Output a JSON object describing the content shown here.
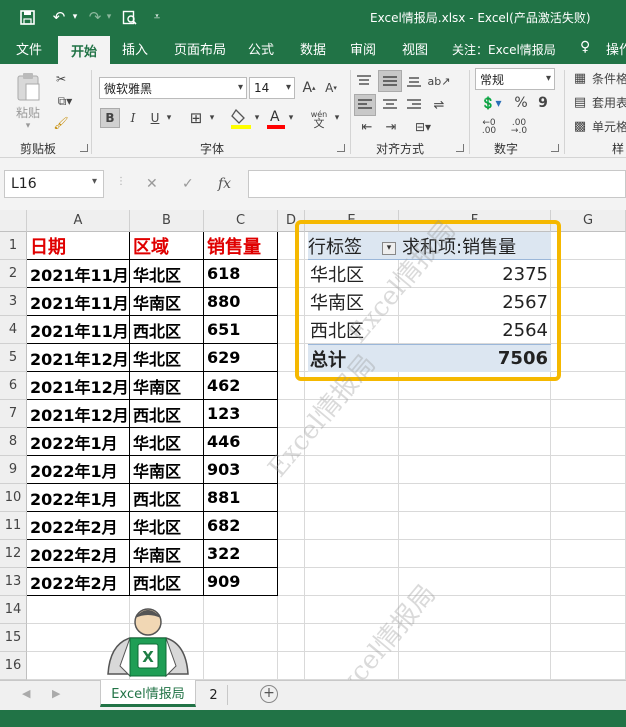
{
  "window": {
    "title": "Excel情报局.xlsx  -  Excel(产品激活失败)"
  },
  "ribbon_tabs": [
    "文件",
    "开始",
    "插入",
    "页面布局",
    "公式",
    "数据",
    "审阅",
    "视图",
    "关注：Excel情报局",
    "操作"
  ],
  "ribbon": {
    "paste_label": "粘贴",
    "font_name": "微软雅黑",
    "font_size": "14",
    "number_format": "常规",
    "bold": "B",
    "italic": "I",
    "underline": "U",
    "percent": "%",
    "comma": "9",
    "styles": [
      "条件格",
      "套用表",
      "单元格"
    ],
    "groups": [
      "剪贴板",
      "字体",
      "对齐方式",
      "数字",
      "样"
    ]
  },
  "formula_bar": {
    "name_box": "L16",
    "fx_label": "fx",
    "formula": ""
  },
  "columns": [
    "A",
    "B",
    "C",
    "D",
    "E",
    "F",
    "G"
  ],
  "rows": [
    "1",
    "2",
    "3",
    "4",
    "5",
    "6",
    "7",
    "8",
    "9",
    "10",
    "11",
    "12",
    "13",
    "14",
    "15",
    "16"
  ],
  "table": {
    "headers": [
      "日期",
      "区域",
      "销售量"
    ],
    "rows": [
      [
        "2021年11月",
        "华北区",
        "618"
      ],
      [
        "2021年11月",
        "华南区",
        "880"
      ],
      [
        "2021年11月",
        "西北区",
        "651"
      ],
      [
        "2021年12月",
        "华北区",
        "629"
      ],
      [
        "2021年12月",
        "华南区",
        "462"
      ],
      [
        "2021年12月",
        "西北区",
        "123"
      ],
      [
        "2022年1月",
        "华北区",
        "446"
      ],
      [
        "2022年1月",
        "华南区",
        "903"
      ],
      [
        "2022年1月",
        "西北区",
        "881"
      ],
      [
        "2022年2月",
        "华北区",
        "682"
      ],
      [
        "2022年2月",
        "华南区",
        "322"
      ],
      [
        "2022年2月",
        "西北区",
        "909"
      ]
    ]
  },
  "pivot": {
    "row_label_header": "行标签",
    "value_header": "求和项:销售量",
    "rows": [
      {
        "label": "华北区",
        "value": "2375"
      },
      {
        "label": "华南区",
        "value": "2567"
      },
      {
        "label": "西北区",
        "value": "2564"
      }
    ],
    "total_label": "总计",
    "total_value": "7506"
  },
  "sheet_tabs": [
    "Excel情报局",
    "2"
  ],
  "watermark": "Excel情报局",
  "colors": {
    "excel_green": "#217346",
    "highlight_border": "#f5b800",
    "header_red": "#e00000",
    "pivot_header_bg": "#dce6f1"
  }
}
